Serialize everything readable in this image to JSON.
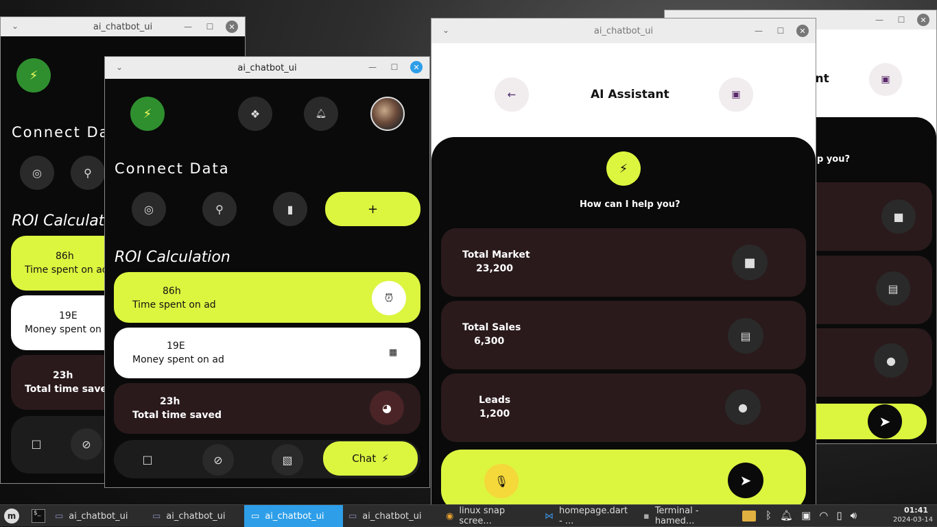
{
  "window_title": "ai_chatbot_ui",
  "win1": {
    "section_connect": "Connect Data",
    "section_roi": "ROI Calculation",
    "cards": [
      {
        "value": "86h",
        "label": "Time spent on ad"
      },
      {
        "value": "19E",
        "label": "Money spent on ad"
      },
      {
        "value": "23h",
        "label": "Total time saved"
      }
    ]
  },
  "win2": {
    "section_connect": "Connect Data",
    "section_roi": "ROI Calculation",
    "add_label": "+",
    "cards": [
      {
        "value": "86h",
        "label": "Time spent on ad"
      },
      {
        "value": "19E",
        "label": "Money spent on ad"
      },
      {
        "value": "23h",
        "label": "Total time saved"
      }
    ],
    "chat_label": "Chat"
  },
  "win3": {
    "header_title": "AI Assistant",
    "prompt": "How can I help you?",
    "stats": [
      {
        "label": "Total Market",
        "value": "23,200"
      },
      {
        "label": "Total Sales",
        "value": "6,300"
      },
      {
        "label": "Leads",
        "value": "1,200"
      }
    ]
  },
  "win4": {
    "header_partial": "ant",
    "prompt_partial": "p you?"
  },
  "taskbar": {
    "items": [
      "ai_chatbot_ui",
      "ai_chatbot_ui",
      "ai_chatbot_ui",
      "ai_chatbot_ui",
      "linux snap scree...",
      "homepage.dart - ...",
      "Terminal - hamed..."
    ],
    "time": "01:41",
    "date": "2024-03-14"
  },
  "colors": {
    "accent": "#dcf53f",
    "card_dark": "#2a1a1c",
    "green": "#2f8f2f",
    "active_task": "#2e9ee8"
  }
}
